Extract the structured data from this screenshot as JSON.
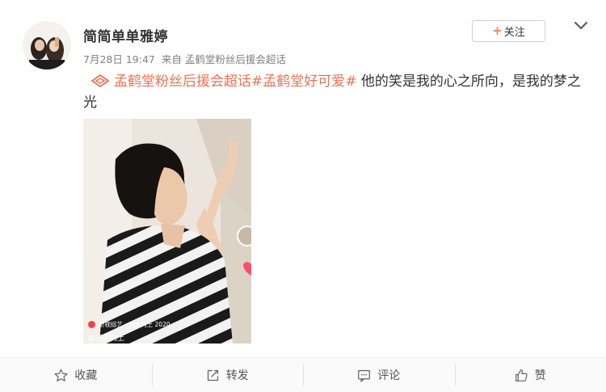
{
  "post": {
    "username": "简简单单雅婷",
    "date": "7月28日 19:47",
    "from_label": "来自",
    "source": "孟鹤堂粉丝后援会超话",
    "follow_label": "关注",
    "content": {
      "topic1": "孟鹤堂粉丝后援会超话",
      "topic2": "#孟鹤堂好可爱#",
      "text": " 他的笑是我的心之所向，是我的梦之光"
    },
    "video": {
      "watermark_brand": "影视综艺 · 天天向上 2020",
      "watermark_show": "@天天向上"
    }
  },
  "actions": {
    "favorite": "收藏",
    "repost": "转发",
    "comment": "评论",
    "like": "赞"
  },
  "colors": {
    "accent": "#ff8140",
    "topic": "#eb7350",
    "meta": "#808080"
  }
}
